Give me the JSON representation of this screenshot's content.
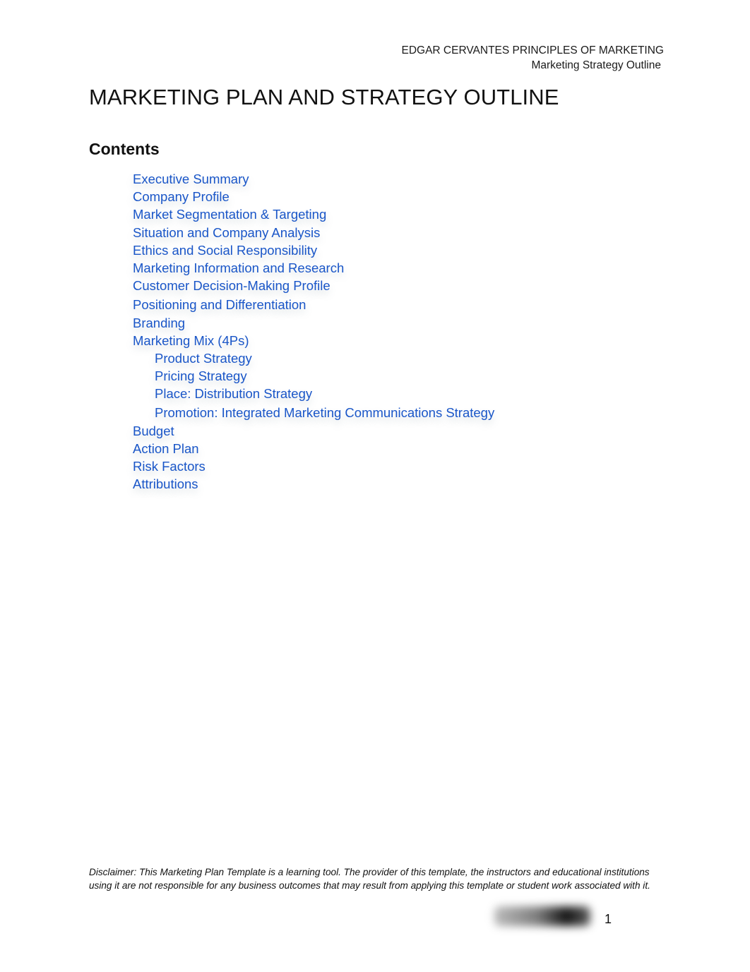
{
  "header": {
    "line1": "EDGAR CERVANTES PRINCIPLES OF MARKETING",
    "line2": "Marketing Strategy Outline"
  },
  "title": "MARKETING PLAN AND STRATEGY OUTLINE",
  "contents": {
    "heading": "Contents",
    "items": [
      {
        "label": "Executive Summary",
        "level": 1
      },
      {
        "label": "Company Profile",
        "level": 1
      },
      {
        "label": "Market Segmentation & Targeting",
        "level": 1
      },
      {
        "label": "Situation and Company Analysis",
        "level": 1
      },
      {
        "label": "Ethics and Social Responsibility",
        "level": 1
      },
      {
        "label": "Marketing Information and Research",
        "level": 1
      },
      {
        "label": "Customer Decision-Making Profile",
        "level": 1
      },
      {
        "label": "Positioning and Differentiation",
        "level": 1
      },
      {
        "label": "Branding",
        "level": 1
      },
      {
        "label": "Marketing Mix (4Ps)",
        "level": 1
      },
      {
        "label": "Product Strategy",
        "level": 2
      },
      {
        "label": "Pricing Strategy",
        "level": 2
      },
      {
        "label": "Place: Distribution Strategy",
        "level": 2
      },
      {
        "label": "Promotion: Integrated Marketing Communications Strategy",
        "level": 2
      },
      {
        "label": "Budget",
        "level": 1
      },
      {
        "label": "Action Plan",
        "level": 1
      },
      {
        "label": "Risk Factors",
        "level": 1
      },
      {
        "label": "Attributions",
        "level": 1
      }
    ],
    "link_color": "#1a56c8"
  },
  "footer": {
    "disclaimer": "Disclaimer: This Marketing Plan Template is a learning tool. The provider of this template, the instructors and educational institutions using it are not responsible for any business outcomes that may result from applying this template or student work associated with it.",
    "page_number": "1"
  }
}
